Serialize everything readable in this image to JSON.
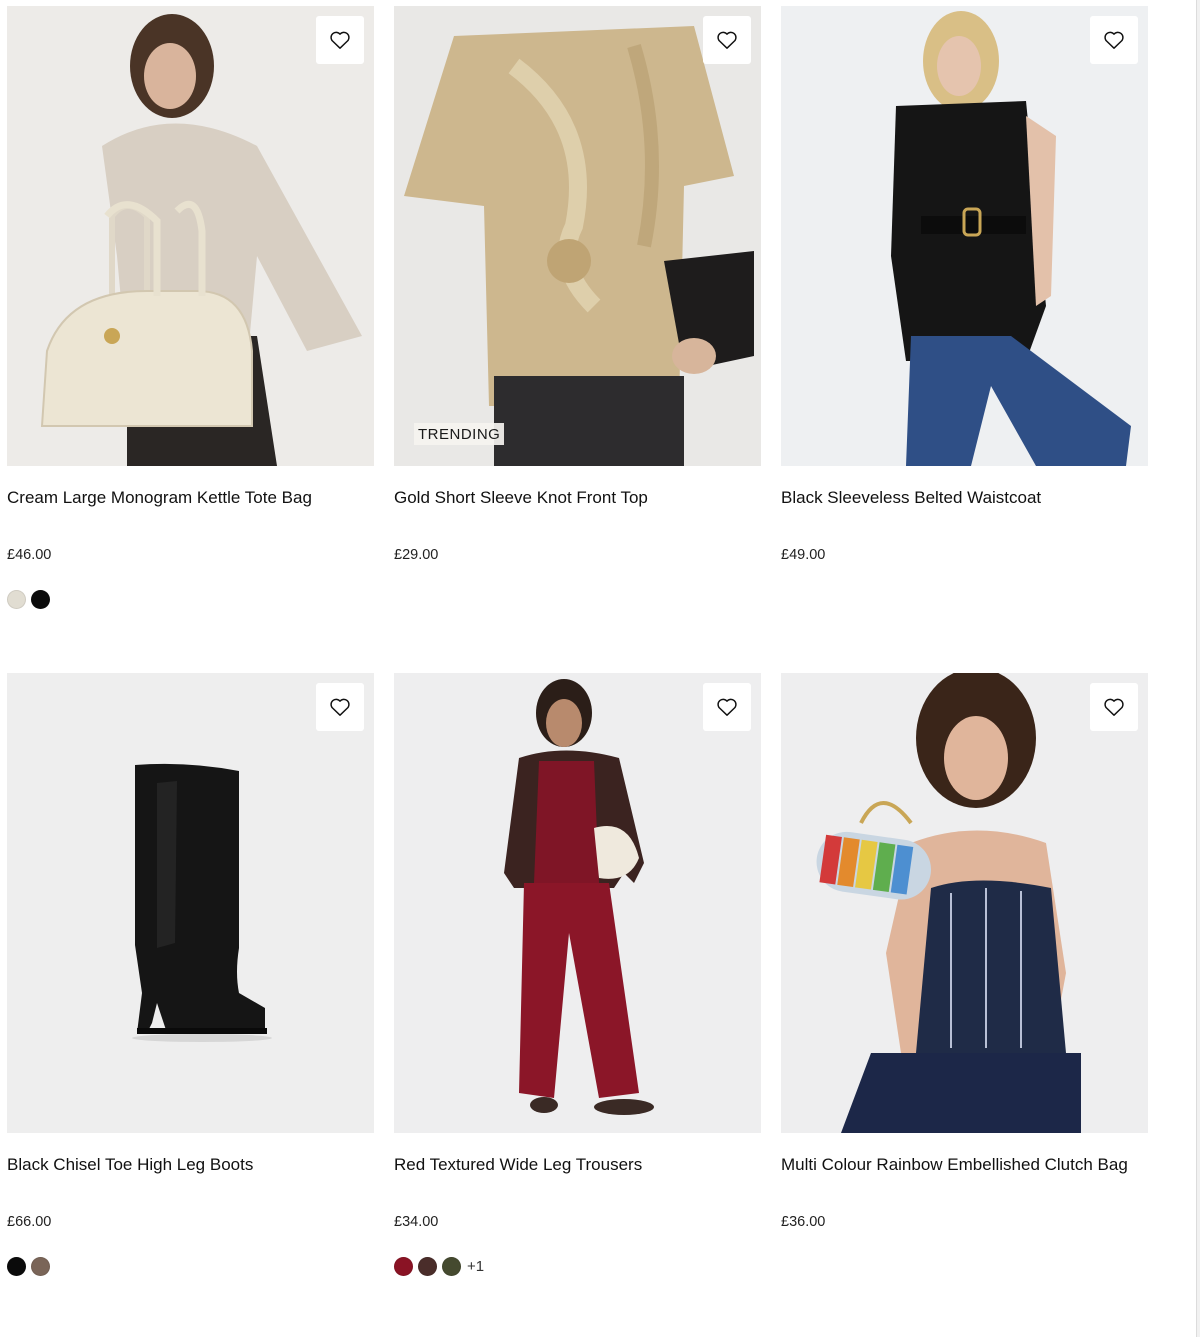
{
  "products": [
    {
      "title": "Cream Large Monogram Kettle Tote Bag",
      "price": "£46.00",
      "image_bg": "#eceae7",
      "swatches": [
        "#e1ddd2",
        "#0b0b0b"
      ],
      "more": ""
    },
    {
      "title": "Gold Short Sleeve Knot Front Top",
      "price": "£29.00",
      "image_bg": "#e8e7e6",
      "badge": "TRENDING",
      "swatches": [],
      "more": ""
    },
    {
      "title": "Black Sleeveless Belted Waistcoat",
      "price": "£49.00",
      "image_bg": "#eeeff1",
      "swatches": [],
      "more": ""
    },
    {
      "title": "Black Chisel Toe High Leg Boots",
      "price": "£66.00",
      "image_bg": "#eeeeee",
      "swatches": [
        "#0b0b0b",
        "#7a6558"
      ],
      "more": ""
    },
    {
      "title": "Red Textured Wide Leg Trousers",
      "price": "£34.00",
      "image_bg": "#ededee",
      "swatches": [
        "#8a1324",
        "#4a2d2a",
        "#454a2f"
      ],
      "more": "+1"
    },
    {
      "title": "Multi Colour Rainbow Embellished Clutch Bag",
      "price": "£36.00",
      "image_bg": "#eeeeef",
      "swatches": [],
      "more": ""
    }
  ],
  "icons": {
    "wishlist": "heart-outline-icon"
  }
}
